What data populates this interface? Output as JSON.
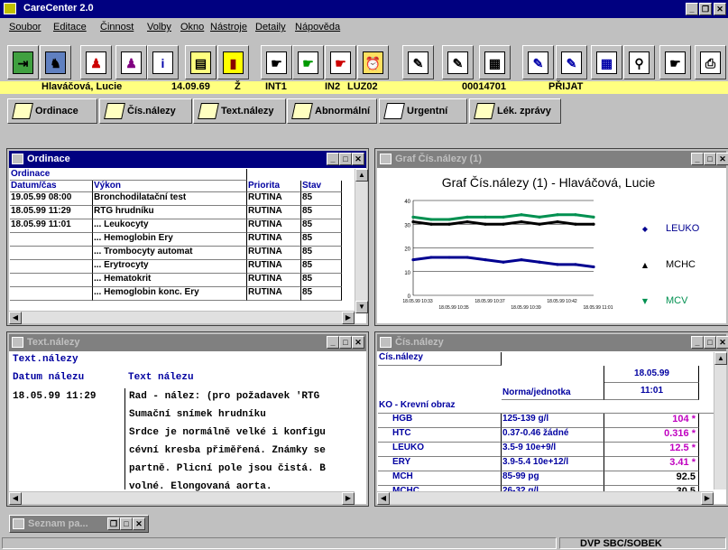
{
  "app": {
    "title": "CareCenter 2.0"
  },
  "menu": [
    "Soubor",
    "Editace",
    "Činnost",
    "Volby",
    "Okno",
    "Nástroje",
    "Detaily",
    "Nápověda"
  ],
  "patient": {
    "name": "Hlaváčová, Lucie",
    "dob": "14.09.69",
    "sex": "Ž",
    "f1": "INT1",
    "f2": "IN2",
    "f3": "LUZ02",
    "id": "00014701",
    "status": "PŘIJAT"
  },
  "tabs": [
    "Ordinace",
    "Čís.nálezy",
    "Text.nálezy",
    "Abnormální",
    "Urgentní",
    "Lék. zprávy"
  ],
  "ordinace": {
    "title": "Ordinace",
    "header": "Ordinace",
    "columns": [
      "Datum/čas",
      "Výkon",
      "Priorita",
      "Stav"
    ],
    "rows": [
      [
        "19.05.99 08:00",
        "Bronchodilatační test",
        "RUTINA",
        "85"
      ],
      [
        "18.05.99 11:29",
        "RTG hrudníku",
        "RUTINA",
        "85"
      ],
      [
        "18.05.99 11:01",
        "... Leukocyty",
        "RUTINA",
        "85"
      ],
      [
        "",
        "... Hemoglobin Ery",
        "RUTINA",
        "85"
      ],
      [
        "",
        "... Trombocyty automat",
        "RUTINA",
        "85"
      ],
      [
        "",
        "... Erytrocyty",
        "RUTINA",
        "85"
      ],
      [
        "",
        "... Hematokrit",
        "RUTINA",
        "85"
      ],
      [
        "",
        "... Hemoglobin konc. Ery",
        "RUTINA",
        "85"
      ]
    ]
  },
  "graf": {
    "wtitle": "Graf Čís.nálezy (1)"
  },
  "chart_data": {
    "type": "line",
    "title": "Graf Čís.nálezy (1) - Hlaváčová, Lucie",
    "ylim": [
      0,
      40
    ],
    "yticks": [
      "40",
      "30",
      "20",
      "10",
      "0"
    ],
    "xticks_top": [
      "18.05.99 10:33",
      "18.05.99 10:37",
      "18.05.99 10:42"
    ],
    "xticks_bottom": [
      "18.05.99 10:35",
      "18.05.99 10:39",
      "18.05.99 11:01"
    ],
    "series": [
      {
        "name": "LEUKO",
        "color": "#000090",
        "marker": "◆",
        "values": [
          15,
          16,
          16,
          16,
          15,
          14,
          15,
          14,
          13,
          13,
          12
        ]
      },
      {
        "name": "MCHC",
        "color": "#000000",
        "marker": "▲",
        "values": [
          31,
          30,
          30,
          31,
          30,
          30,
          31,
          30,
          31,
          30,
          30
        ]
      },
      {
        "name": "MCV",
        "color": "#009050",
        "marker": "▼",
        "values": [
          33,
          32,
          32,
          33,
          33,
          33,
          34,
          33,
          34,
          34,
          33
        ]
      }
    ],
    "legend_pos": "right"
  },
  "textnal": {
    "title": "Text.nálezy",
    "header": "Text.nálezy",
    "col1": "Datum nálezu",
    "col2": "Text nálezu",
    "date": "18.05.99 11:29",
    "lines": [
      "Rad - nález: (pro požadavek 'RTG",
      "Sumační snímek hrudníku",
      "Srdce je normálně velké i konfigu",
      "cévní kresba přiměřená. Známky se",
      "partně. Plicní pole jsou čistá. B",
      "volné. Elongovaná aorta."
    ]
  },
  "cisnal": {
    "title": "Čís.nálezy",
    "header": "Čís.nálezy",
    "date": "18.05.99",
    "time": "11:01",
    "normcol": "Norma/jednotka",
    "group": "KO - Krevní obraz",
    "rows": [
      [
        "HGB",
        "125-139 g/l",
        "104 *"
      ],
      [
        "HTC",
        "0.37-0.46 žádné",
        "0.316 *"
      ],
      [
        "LEUKO",
        "3.5-9 10e+9/l",
        "12.5 *"
      ],
      [
        "ERY",
        "3.9-5.4 10e+12/l",
        "3.41 *"
      ],
      [
        "MCH",
        "85-99 pg",
        "92.5"
      ],
      [
        "MCHC",
        "26-32 g/l",
        "30.5"
      ]
    ]
  },
  "taskbar": {
    "label": "Seznam pa..."
  },
  "status": {
    "text": "DVP  SBC/SOBEK"
  }
}
